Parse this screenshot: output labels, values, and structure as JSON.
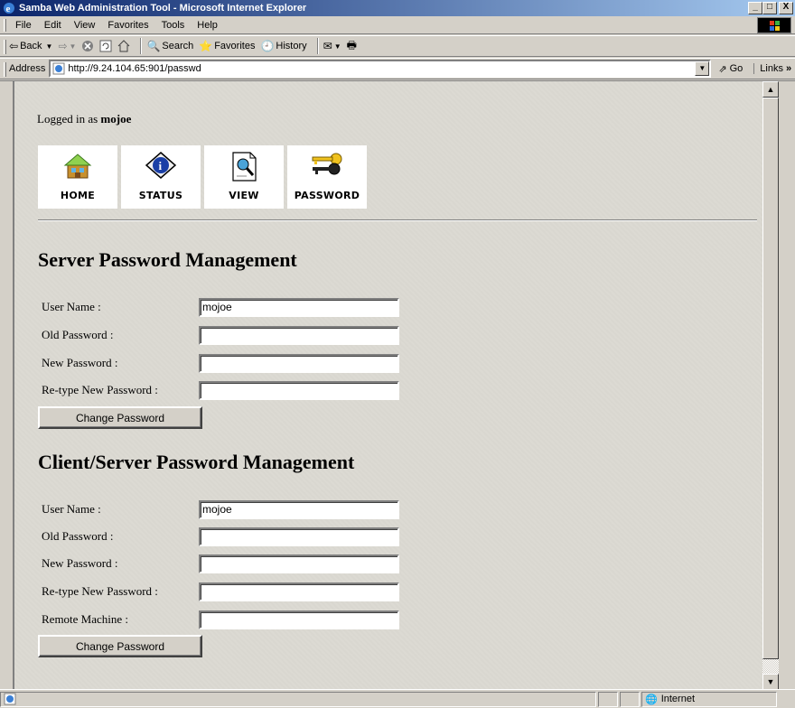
{
  "window": {
    "title": "Samba Web Administration Tool - Microsoft Internet Explorer",
    "minimize": "_",
    "maximize": "□",
    "close": "X"
  },
  "menu": [
    {
      "label": "File"
    },
    {
      "label": "Edit"
    },
    {
      "label": "View"
    },
    {
      "label": "Favorites"
    },
    {
      "label": "Tools"
    },
    {
      "label": "Help"
    }
  ],
  "toolbar": {
    "back": "Back",
    "search": "Search",
    "favorites": "Favorites",
    "history": "History"
  },
  "address": {
    "label": "Address",
    "url": "http://9.24.104.65:901/passwd",
    "go": "Go",
    "links": "Links"
  },
  "page": {
    "logged_in_prefix": "Logged in as ",
    "logged_in_user": "mojoe",
    "nav": [
      {
        "label": "HOME",
        "icon": "home-icon"
      },
      {
        "label": "STATUS",
        "icon": "status-icon"
      },
      {
        "label": "VIEW",
        "icon": "view-icon"
      },
      {
        "label": "PASSWORD",
        "icon": "password-keys-icon"
      }
    ],
    "server_section": {
      "heading": "Server Password Management",
      "user_name_label": "User Name :",
      "user_name_value": "mojoe",
      "old_password_label": "Old Password :",
      "new_password_label": "New Password :",
      "retype_label": "Re-type New Password :",
      "button": "Change Password"
    },
    "client_section": {
      "heading": "Client/Server Password Management",
      "user_name_label": "User Name :",
      "user_name_value": "mojoe",
      "old_password_label": "Old Password :",
      "new_password_label": "New Password :",
      "retype_label": "Re-type New Password :",
      "remote_label": "Remote Machine :",
      "button": "Change Password"
    }
  },
  "status": {
    "zone": "Internet"
  }
}
